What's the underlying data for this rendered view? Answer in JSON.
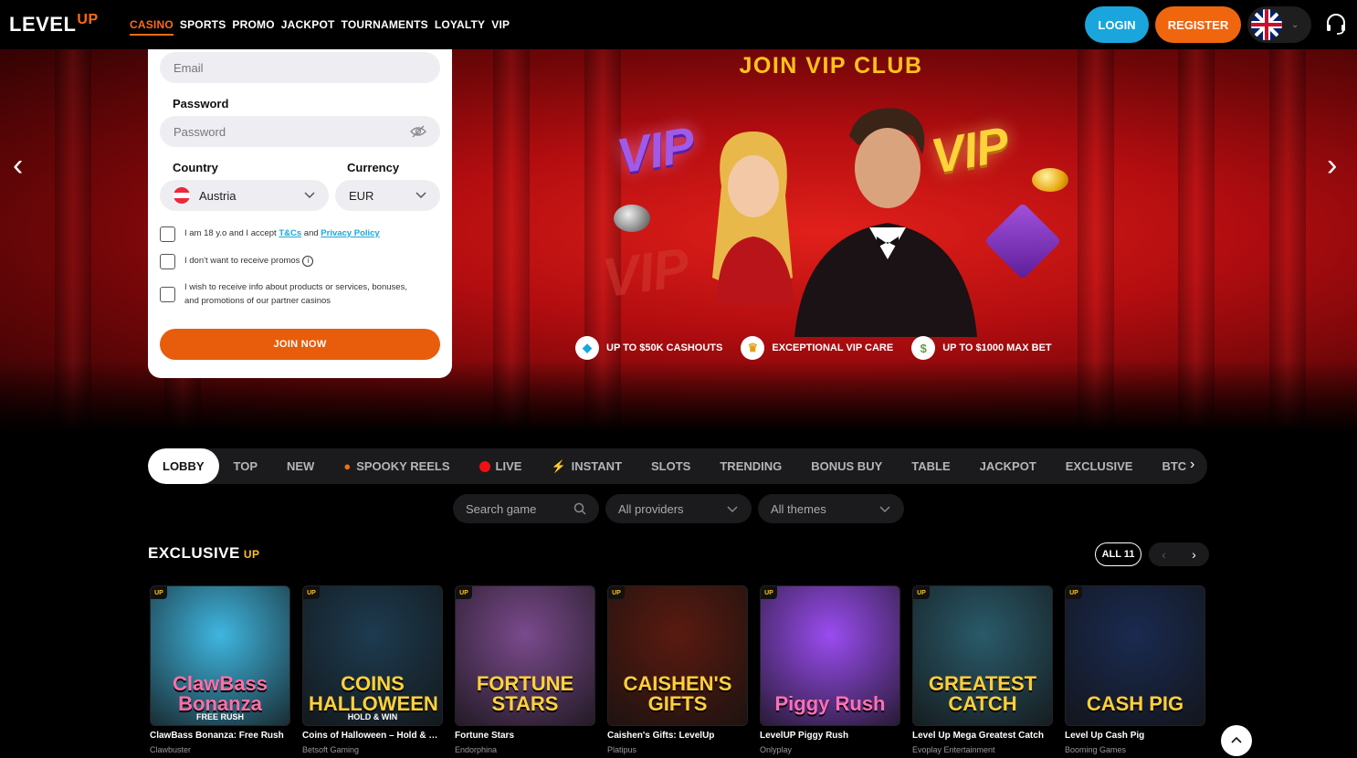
{
  "header": {
    "logo_text": "LEVEL",
    "logo_up": "UP",
    "nav": [
      "CASINO",
      "SPORTS",
      "PROMO",
      "JACKPOT",
      "TOURNAMENTS",
      "LOYALTY",
      "VIP"
    ],
    "login_label": "LOGIN",
    "register_label": "REGISTER",
    "language_icon": "uk-flag-icon",
    "support_icon": "headset-icon"
  },
  "hero": {
    "title": "JOIN VIP CLUB",
    "vip_words": [
      "VIP",
      "VIP",
      "VIP"
    ],
    "perks": [
      {
        "icon": "diamond-icon",
        "label": "UP TO $50K CASHOUTS"
      },
      {
        "icon": "crown-icon",
        "label": "EXCEPTIONAL VIP CARE"
      },
      {
        "icon": "money-icon",
        "label": "UP TO $1000 MAX BET"
      }
    ]
  },
  "form": {
    "email_placeholder": "Email",
    "password_label": "Password",
    "password_placeholder": "Password",
    "country_label": "Country",
    "country_value": "Austria",
    "currency_label": "Currency",
    "currency_value": "EUR",
    "terms_prefix": "I am 18 y.o and I accept",
    "terms_link": "T&Cs",
    "terms_and": "and",
    "privacy_link": "Privacy Policy",
    "promos_text": "I don't want to receive promos",
    "partner_text": "I wish to receive info about products or services, bonuses, and promotions of our partner casinos",
    "join_label": "JOIN NOW"
  },
  "tabs": [
    "LOBBY",
    "TOP",
    "NEW",
    "SPOOKY REELS",
    "LIVE",
    "INSTANT",
    "SLOTS",
    "TRENDING",
    "BONUS BUY",
    "TABLE",
    "JACKPOT",
    "EXCLUSIVE",
    "BTC"
  ],
  "filters": {
    "search_placeholder": "Search game",
    "providers": "All providers",
    "themes": "All themes"
  },
  "exclusive": {
    "title": "EXCLUSIVE",
    "badge": "UP",
    "all_label": "ALL 11",
    "games": [
      {
        "name": "ClawBass Bonanza: Free Rush",
        "provider": "Clawbuster",
        "art": "ClawBass Bonanza",
        "art_sub": "FREE RUSH",
        "bg": "#3fb6e0",
        "fg": "#ff6fa8"
      },
      {
        "name": "Coins of Halloween – Hold & Win",
        "provider": "Betsoft Gaming",
        "art": "COINS HALLOWEEN",
        "art_sub": "HOLD & WIN",
        "bg": "#1d3b50",
        "fg": "#ffd23a"
      },
      {
        "name": "Fortune Stars",
        "provider": "Endorphina",
        "art": "FORTUNE STARS",
        "art_sub": "",
        "bg": "#7a4a8c",
        "fg": "#ffd23a"
      },
      {
        "name": "Caishen's Gifts: LevelUp",
        "provider": "Platipus",
        "art": "CAISHEN'S GIFTS",
        "art_sub": "",
        "bg": "#5a1a10",
        "fg": "#ffcf3a"
      },
      {
        "name": "LevelUP Piggy Rush",
        "provider": "Onlyplay",
        "art": "Piggy Rush",
        "art_sub": "",
        "bg": "#9a4cf0",
        "fg": "#ff6fb8"
      },
      {
        "name": "Level Up Mega Greatest Catch",
        "provider": "Evoplay Entertainment",
        "art": "GREATEST CATCH",
        "art_sub": "",
        "bg": "#2a5a6a",
        "fg": "#ffcf3a"
      },
      {
        "name": "Level Up Cash Pig",
        "provider": "Booming Games",
        "art": "CASH PIG",
        "art_sub": "",
        "bg": "#1a2a50",
        "fg": "#ffcf3a"
      }
    ]
  }
}
